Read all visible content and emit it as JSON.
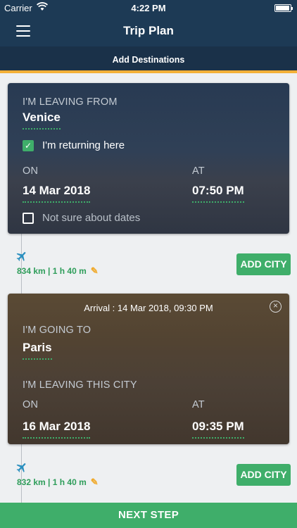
{
  "status_bar": {
    "carrier": "Carrier",
    "time": "4:22 PM"
  },
  "nav": {
    "title": "Trip Plan",
    "subtitle": "Add Destinations"
  },
  "origin": {
    "leaving_label": "I'M LEAVING FROM",
    "city": "Venice",
    "returning_label": "I'm returning here",
    "returning_checked": true,
    "on_label": "ON",
    "date": "14 Mar 2018",
    "at_label": "AT",
    "time": "07:50 PM",
    "not_sure_label": "Not sure about dates",
    "not_sure_checked": false
  },
  "leg1": {
    "distance": "834 km | 1 h 40 m",
    "add_city_label": "ADD CITY"
  },
  "destination": {
    "arrival": "Arrival : 14 Mar 2018, 09:30 PM",
    "going_label": "I'M GOING TO",
    "city": "Paris",
    "leaving_label": "I'M LEAVING THIS CITY",
    "on_label": "ON",
    "date": "16 Mar 2018",
    "at_label": "AT",
    "time": "09:35 PM"
  },
  "leg2": {
    "distance": "832 km | 1 h 40 m",
    "add_city_label": "ADD CITY"
  },
  "footer": {
    "next_step_label": "NEXT STEP"
  },
  "colors": {
    "nav": "#1d3a55",
    "accent_green": "#3fae6a",
    "accent_orange": "#f3b038"
  },
  "icons": [
    "wifi-icon",
    "battery-icon",
    "menu-icon",
    "check-icon",
    "plane-icon",
    "pencil-icon",
    "close-icon"
  ]
}
